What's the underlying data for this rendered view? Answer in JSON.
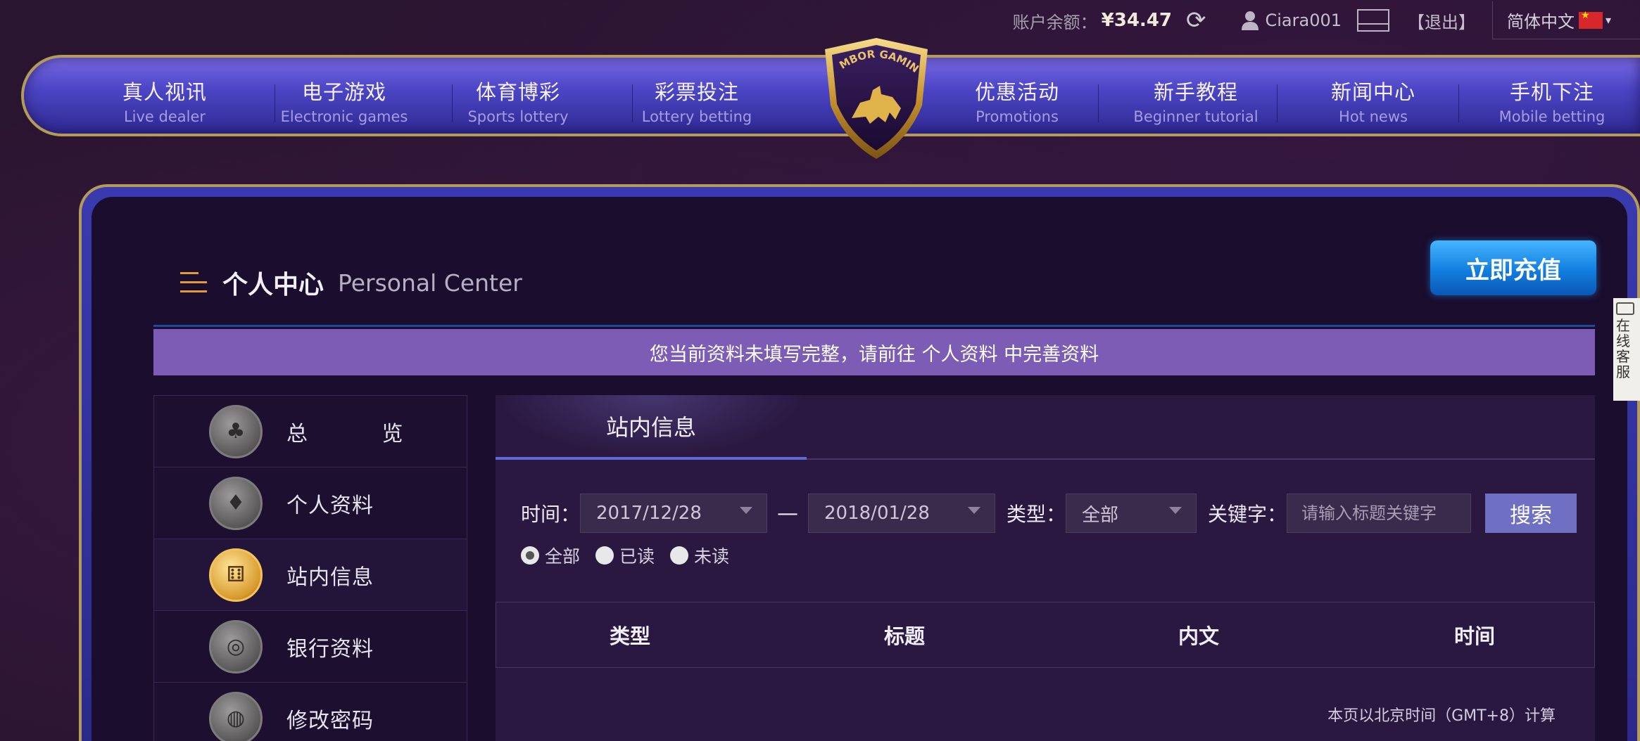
{
  "topbar": {
    "balance_label": "账户余额：",
    "balance_value": "¥34.47",
    "username": "Ciara001",
    "logout": "【退出】",
    "language": "简体中文"
  },
  "nav": {
    "items": [
      {
        "zh": "真人视讯",
        "en": "Live dealer"
      },
      {
        "zh": "电子游戏",
        "en": "Electronic games"
      },
      {
        "zh": "体育博彩",
        "en": "Sports lottery"
      },
      {
        "zh": "彩票投注",
        "en": "Lottery betting"
      },
      {
        "zh": "优惠活动",
        "en": "Promotions"
      },
      {
        "zh": "新手教程",
        "en": "Beginner tutorial"
      },
      {
        "zh": "新闻中心",
        "en": "Hot news"
      },
      {
        "zh": "手机下注",
        "en": "Mobile betting"
      }
    ],
    "logo_text": "LAMBOR GAMING"
  },
  "header": {
    "title_zh": "个人中心",
    "title_en": "Personal Center",
    "recharge_label": "立即充值"
  },
  "notice": "您当前资料未填写完整，请前往 个人资料 中完善资料",
  "sidebar": {
    "items": [
      {
        "label": "总 览",
        "icon": "clubs-card-icon"
      },
      {
        "label": "个人资料",
        "icon": "diamond-card-icon"
      },
      {
        "label": "站内信息",
        "icon": "dice-icon"
      },
      {
        "label": "银行资料",
        "icon": "roulette-icon"
      },
      {
        "label": "修改密码",
        "icon": "chips-icon"
      }
    ]
  },
  "content": {
    "tab_label": "站内信息",
    "filters": {
      "time_label": "时间：",
      "start_date": "2017/12/28",
      "separator": "—",
      "end_date": "2018/01/28",
      "type_label": "类型：",
      "type_value": "全部",
      "keyword_label": "关键字：",
      "keyword_placeholder": "请输入标题关键字",
      "search_label": "搜索"
    },
    "radios": [
      {
        "label": "全部",
        "checked": true
      },
      {
        "label": "已读",
        "checked": false
      },
      {
        "label": "未读",
        "checked": false
      }
    ],
    "table_headers": [
      "类型",
      "标题",
      "内文",
      "时间"
    ],
    "timezone_note": "本页以北京时间（GMT+8）计算"
  },
  "float_tab": {
    "lines": [
      "在",
      "线",
      "客",
      "服"
    ]
  }
}
